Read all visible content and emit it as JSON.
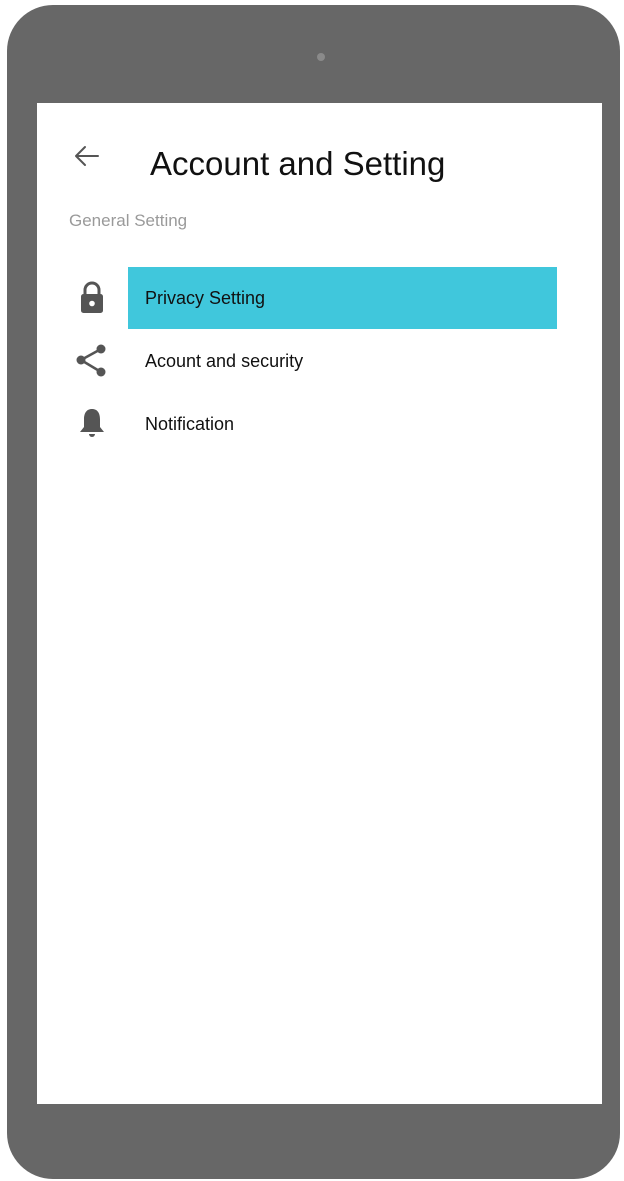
{
  "header": {
    "title": "Account and Setting",
    "back_icon": "arrow-left-icon"
  },
  "section": {
    "label": "General Setting"
  },
  "menu": {
    "items": [
      {
        "label": "Privacy Setting",
        "icon": "lock-icon",
        "selected": true
      },
      {
        "label": "Acount and security",
        "icon": "share-icon",
        "selected": false
      },
      {
        "label": "Notification",
        "icon": "bell-icon",
        "selected": false
      }
    ]
  },
  "colors": {
    "device_frame": "#676767",
    "highlight": "#40c7dc",
    "icon": "#555555",
    "section_label": "#9a9a9a"
  }
}
